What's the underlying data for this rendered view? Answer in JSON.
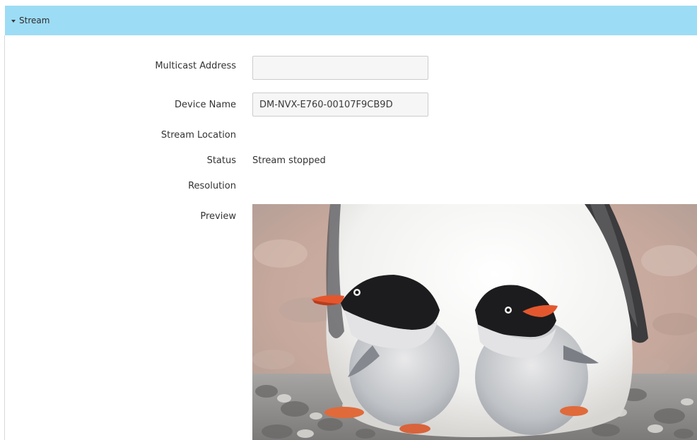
{
  "section": {
    "title": "Stream",
    "expanded": true,
    "header_color": "#9ddcf5"
  },
  "fields": {
    "multicast_address": {
      "label": "Multicast Address",
      "value": ""
    },
    "device_name": {
      "label": "Device Name",
      "value": "DM-NVX-E760-00107F9CB9D"
    },
    "stream_location": {
      "label": "Stream Location",
      "value": ""
    },
    "status": {
      "label": "Status",
      "value": "Stream stopped"
    },
    "resolution": {
      "label": "Resolution",
      "value": ""
    },
    "preview": {
      "label": "Preview"
    }
  },
  "icons": {
    "section_toggle": "caret-down-icon"
  }
}
